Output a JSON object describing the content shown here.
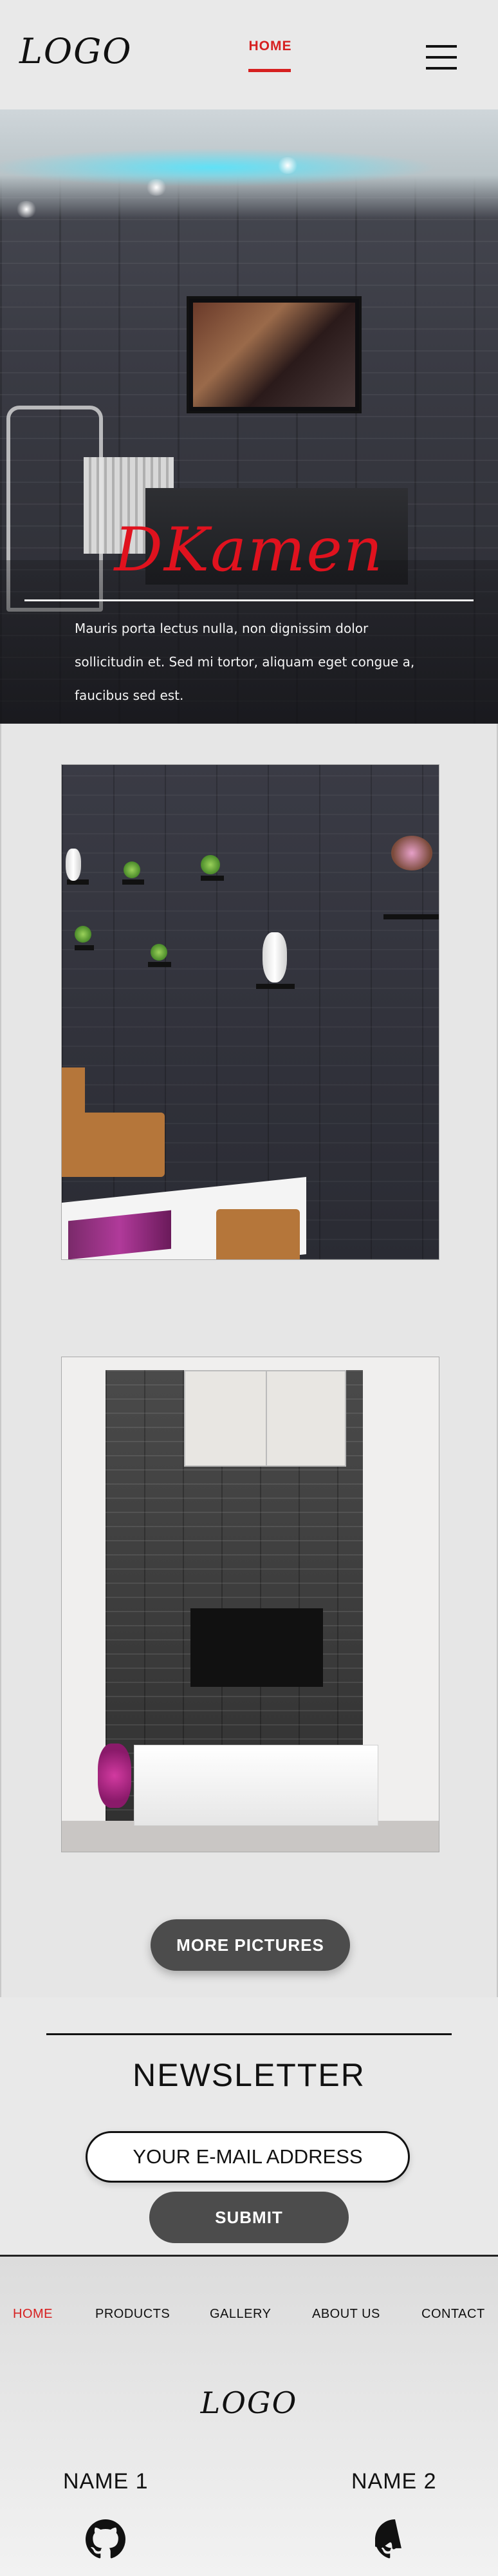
{
  "header": {
    "logo": "LOGO",
    "nav_home": "HOME"
  },
  "hero": {
    "brand": "DKamen",
    "text": "Mauris porta lectus nulla, non dignissim dolor sollicitudin et. Sed mi tortor, aliquam eget congue a, faucibus sed est."
  },
  "gallery": {
    "more_button": "MORE PICTURES"
  },
  "newsletter": {
    "title": "NEWSLETTER",
    "email_placeholder": "YOUR E-MAIL ADDRESS",
    "submit_label": "SUBMIT"
  },
  "footer": {
    "nav": [
      {
        "label": "HOME"
      },
      {
        "label": "PRODUCTS"
      },
      {
        "label": "GALLERY"
      },
      {
        "label": "ABOUT US"
      },
      {
        "label": "CONTACT"
      }
    ],
    "logo": "LOGO",
    "names": [
      "NAME 1",
      "NAME 2"
    ]
  },
  "icons": {
    "menu": "hamburger-icon",
    "github": "github-icon"
  },
  "colors": {
    "accent": "#d62020",
    "brand": "#e0121e",
    "button": "#4c4c4c"
  }
}
